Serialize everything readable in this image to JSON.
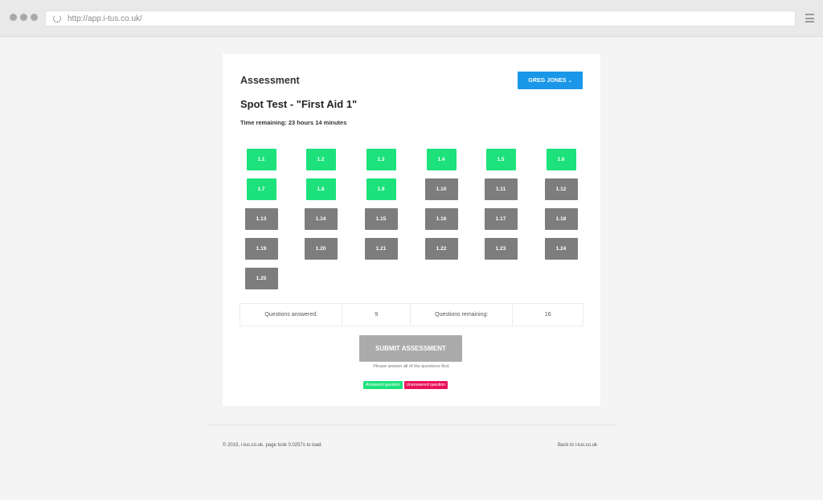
{
  "browser": {
    "url": "http://app.i-tus.co.uk/"
  },
  "page": {
    "title": "Assessment",
    "user_button": "GREG JONES",
    "test_title": "Spot Test - \"First Aid 1\"",
    "time_remaining": "Time remaining: 23 hours 14 minutes"
  },
  "questions": [
    {
      "label": "1.1",
      "answered": true
    },
    {
      "label": "1.2",
      "answered": true
    },
    {
      "label": "1.3",
      "answered": true
    },
    {
      "label": "1.4",
      "answered": true
    },
    {
      "label": "1.5",
      "answered": true
    },
    {
      "label": "1.6",
      "answered": true
    },
    {
      "label": "1.7",
      "answered": true
    },
    {
      "label": "1.8",
      "answered": true
    },
    {
      "label": "1.9",
      "answered": true
    },
    {
      "label": "1.10",
      "answered": false
    },
    {
      "label": "1.11",
      "answered": false
    },
    {
      "label": "1.12",
      "answered": false
    },
    {
      "label": "1.13",
      "answered": false
    },
    {
      "label": "1.14",
      "answered": false
    },
    {
      "label": "1.15",
      "answered": false
    },
    {
      "label": "1.16",
      "answered": false
    },
    {
      "label": "1.17",
      "answered": false
    },
    {
      "label": "1.18",
      "answered": false
    },
    {
      "label": "1.19",
      "answered": false
    },
    {
      "label": "1.20",
      "answered": false
    },
    {
      "label": "1.21",
      "answered": false
    },
    {
      "label": "1.22",
      "answered": false
    },
    {
      "label": "1.23",
      "answered": false
    },
    {
      "label": "1.24",
      "answered": false
    },
    {
      "label": "1.25",
      "answered": false
    }
  ],
  "stats": {
    "answered_label": "Questions answered:",
    "answered_value": "9",
    "remaining_label": "Questions remaining:",
    "remaining_value": "16"
  },
  "submit": {
    "label": "SUBMIT ASSESSMENT",
    "hint": "Please answer all of the questions first."
  },
  "legend": {
    "answered": "Answered question",
    "unanswered": "Unanswered question"
  },
  "footer": {
    "left": "© 2015, i-tus.co.uk, page took 0.0257s to load.",
    "right": "Back to i-tus.co.uk"
  },
  "colors": {
    "answered": "#1de27c",
    "unanswered_tile": "#7d7d7d",
    "unanswered_legend": "#e8135a",
    "primary": "#1a97e8",
    "submit_disabled": "#ababab"
  }
}
